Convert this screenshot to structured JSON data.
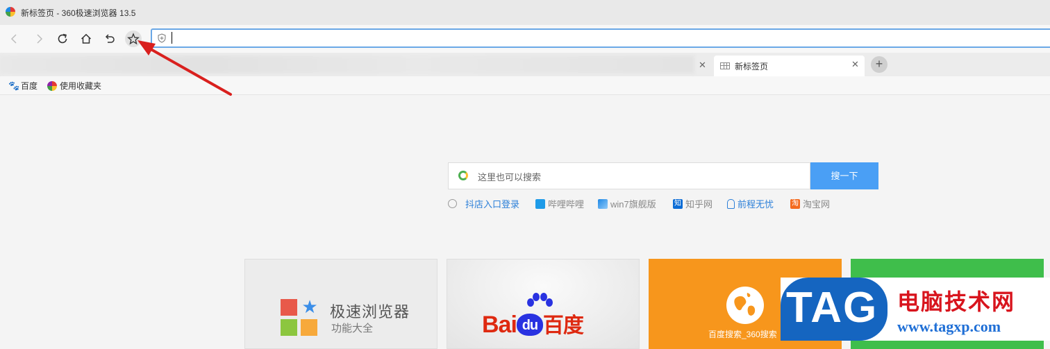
{
  "window": {
    "title": "新标签页 - 360极速浏览器 13.5"
  },
  "toolbar": {
    "back_icon": "chevron-left-icon",
    "forward_icon": "chevron-right-icon",
    "reload_icon": "reload-icon",
    "home_icon": "home-icon",
    "undo_icon": "undo-close-tab-icon",
    "star_icon": "star-icon",
    "address_value": ""
  },
  "tabs": [
    {
      "label": "新标签页"
    }
  ],
  "bookmarks": [
    {
      "label": "百度",
      "icon": "baidu-paw-icon"
    },
    {
      "label": "使用收藏夹",
      "icon": "360-logo-icon"
    }
  ],
  "search": {
    "placeholder": "这里也可以搜索",
    "button": "搜一下"
  },
  "quick_links": [
    {
      "label": "抖店入口登录",
      "color": "#2b7fd8"
    },
    {
      "label": "哔哩哔哩",
      "color": "#888888"
    },
    {
      "label": "win7旗舰版",
      "color": "#888888"
    },
    {
      "label": "知乎网",
      "color": "#888888"
    },
    {
      "label": "前程无忧",
      "color": "#2b7fd8"
    },
    {
      "label": "淘宝网",
      "color": "#888888"
    }
  ],
  "tiles": [
    {
      "title": "极速浏览器",
      "subtitle": "功能大全"
    },
    {
      "brand_a": "Bai",
      "brand_b": "du",
      "brand_c": "百度"
    },
    {
      "label": "百度搜索_360搜索"
    },
    {
      "label": ""
    }
  ],
  "watermark": {
    "badge": "TAG",
    "cn": "电脑技术网",
    "url": "www.tagxp.com"
  },
  "colors": {
    "accent": "#4a9ff5",
    "address_border": "#6aa8e6",
    "annotation": "#d9201e"
  }
}
